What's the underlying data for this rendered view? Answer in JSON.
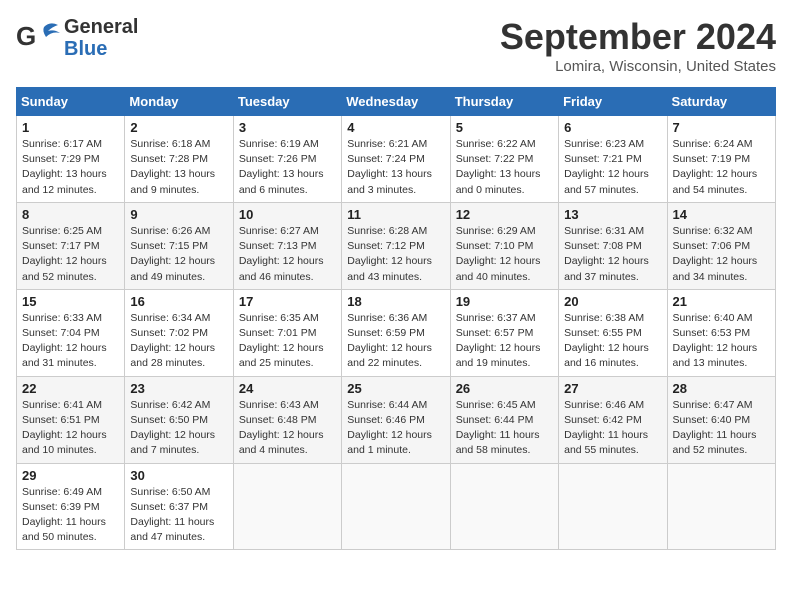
{
  "header": {
    "logo_line1": "General",
    "logo_line2": "Blue",
    "month": "September 2024",
    "location": "Lomira, Wisconsin, United States"
  },
  "weekdays": [
    "Sunday",
    "Monday",
    "Tuesday",
    "Wednesday",
    "Thursday",
    "Friday",
    "Saturday"
  ],
  "weeks": [
    [
      {
        "day": "1",
        "rise": "Sunrise: 6:17 AM",
        "set": "Sunset: 7:29 PM",
        "daylight": "Daylight: 13 hours and 12 minutes."
      },
      {
        "day": "2",
        "rise": "Sunrise: 6:18 AM",
        "set": "Sunset: 7:28 PM",
        "daylight": "Daylight: 13 hours and 9 minutes."
      },
      {
        "day": "3",
        "rise": "Sunrise: 6:19 AM",
        "set": "Sunset: 7:26 PM",
        "daylight": "Daylight: 13 hours and 6 minutes."
      },
      {
        "day": "4",
        "rise": "Sunrise: 6:21 AM",
        "set": "Sunset: 7:24 PM",
        "daylight": "Daylight: 13 hours and 3 minutes."
      },
      {
        "day": "5",
        "rise": "Sunrise: 6:22 AM",
        "set": "Sunset: 7:22 PM",
        "daylight": "Daylight: 13 hours and 0 minutes."
      },
      {
        "day": "6",
        "rise": "Sunrise: 6:23 AM",
        "set": "Sunset: 7:21 PM",
        "daylight": "Daylight: 12 hours and 57 minutes."
      },
      {
        "day": "7",
        "rise": "Sunrise: 6:24 AM",
        "set": "Sunset: 7:19 PM",
        "daylight": "Daylight: 12 hours and 54 minutes."
      }
    ],
    [
      {
        "day": "8",
        "rise": "Sunrise: 6:25 AM",
        "set": "Sunset: 7:17 PM",
        "daylight": "Daylight: 12 hours and 52 minutes."
      },
      {
        "day": "9",
        "rise": "Sunrise: 6:26 AM",
        "set": "Sunset: 7:15 PM",
        "daylight": "Daylight: 12 hours and 49 minutes."
      },
      {
        "day": "10",
        "rise": "Sunrise: 6:27 AM",
        "set": "Sunset: 7:13 PM",
        "daylight": "Daylight: 12 hours and 46 minutes."
      },
      {
        "day": "11",
        "rise": "Sunrise: 6:28 AM",
        "set": "Sunset: 7:12 PM",
        "daylight": "Daylight: 12 hours and 43 minutes."
      },
      {
        "day": "12",
        "rise": "Sunrise: 6:29 AM",
        "set": "Sunset: 7:10 PM",
        "daylight": "Daylight: 12 hours and 40 minutes."
      },
      {
        "day": "13",
        "rise": "Sunrise: 6:31 AM",
        "set": "Sunset: 7:08 PM",
        "daylight": "Daylight: 12 hours and 37 minutes."
      },
      {
        "day": "14",
        "rise": "Sunrise: 6:32 AM",
        "set": "Sunset: 7:06 PM",
        "daylight": "Daylight: 12 hours and 34 minutes."
      }
    ],
    [
      {
        "day": "15",
        "rise": "Sunrise: 6:33 AM",
        "set": "Sunset: 7:04 PM",
        "daylight": "Daylight: 12 hours and 31 minutes."
      },
      {
        "day": "16",
        "rise": "Sunrise: 6:34 AM",
        "set": "Sunset: 7:02 PM",
        "daylight": "Daylight: 12 hours and 28 minutes."
      },
      {
        "day": "17",
        "rise": "Sunrise: 6:35 AM",
        "set": "Sunset: 7:01 PM",
        "daylight": "Daylight: 12 hours and 25 minutes."
      },
      {
        "day": "18",
        "rise": "Sunrise: 6:36 AM",
        "set": "Sunset: 6:59 PM",
        "daylight": "Daylight: 12 hours and 22 minutes."
      },
      {
        "day": "19",
        "rise": "Sunrise: 6:37 AM",
        "set": "Sunset: 6:57 PM",
        "daylight": "Daylight: 12 hours and 19 minutes."
      },
      {
        "day": "20",
        "rise": "Sunrise: 6:38 AM",
        "set": "Sunset: 6:55 PM",
        "daylight": "Daylight: 12 hours and 16 minutes."
      },
      {
        "day": "21",
        "rise": "Sunrise: 6:40 AM",
        "set": "Sunset: 6:53 PM",
        "daylight": "Daylight: 12 hours and 13 minutes."
      }
    ],
    [
      {
        "day": "22",
        "rise": "Sunrise: 6:41 AM",
        "set": "Sunset: 6:51 PM",
        "daylight": "Daylight: 12 hours and 10 minutes."
      },
      {
        "day": "23",
        "rise": "Sunrise: 6:42 AM",
        "set": "Sunset: 6:50 PM",
        "daylight": "Daylight: 12 hours and 7 minutes."
      },
      {
        "day": "24",
        "rise": "Sunrise: 6:43 AM",
        "set": "Sunset: 6:48 PM",
        "daylight": "Daylight: 12 hours and 4 minutes."
      },
      {
        "day": "25",
        "rise": "Sunrise: 6:44 AM",
        "set": "Sunset: 6:46 PM",
        "daylight": "Daylight: 12 hours and 1 minute."
      },
      {
        "day": "26",
        "rise": "Sunrise: 6:45 AM",
        "set": "Sunset: 6:44 PM",
        "daylight": "Daylight: 11 hours and 58 minutes."
      },
      {
        "day": "27",
        "rise": "Sunrise: 6:46 AM",
        "set": "Sunset: 6:42 PM",
        "daylight": "Daylight: 11 hours and 55 minutes."
      },
      {
        "day": "28",
        "rise": "Sunrise: 6:47 AM",
        "set": "Sunset: 6:40 PM",
        "daylight": "Daylight: 11 hours and 52 minutes."
      }
    ],
    [
      {
        "day": "29",
        "rise": "Sunrise: 6:49 AM",
        "set": "Sunset: 6:39 PM",
        "daylight": "Daylight: 11 hours and 50 minutes."
      },
      {
        "day": "30",
        "rise": "Sunrise: 6:50 AM",
        "set": "Sunset: 6:37 PM",
        "daylight": "Daylight: 11 hours and 47 minutes."
      },
      null,
      null,
      null,
      null,
      null
    ]
  ]
}
